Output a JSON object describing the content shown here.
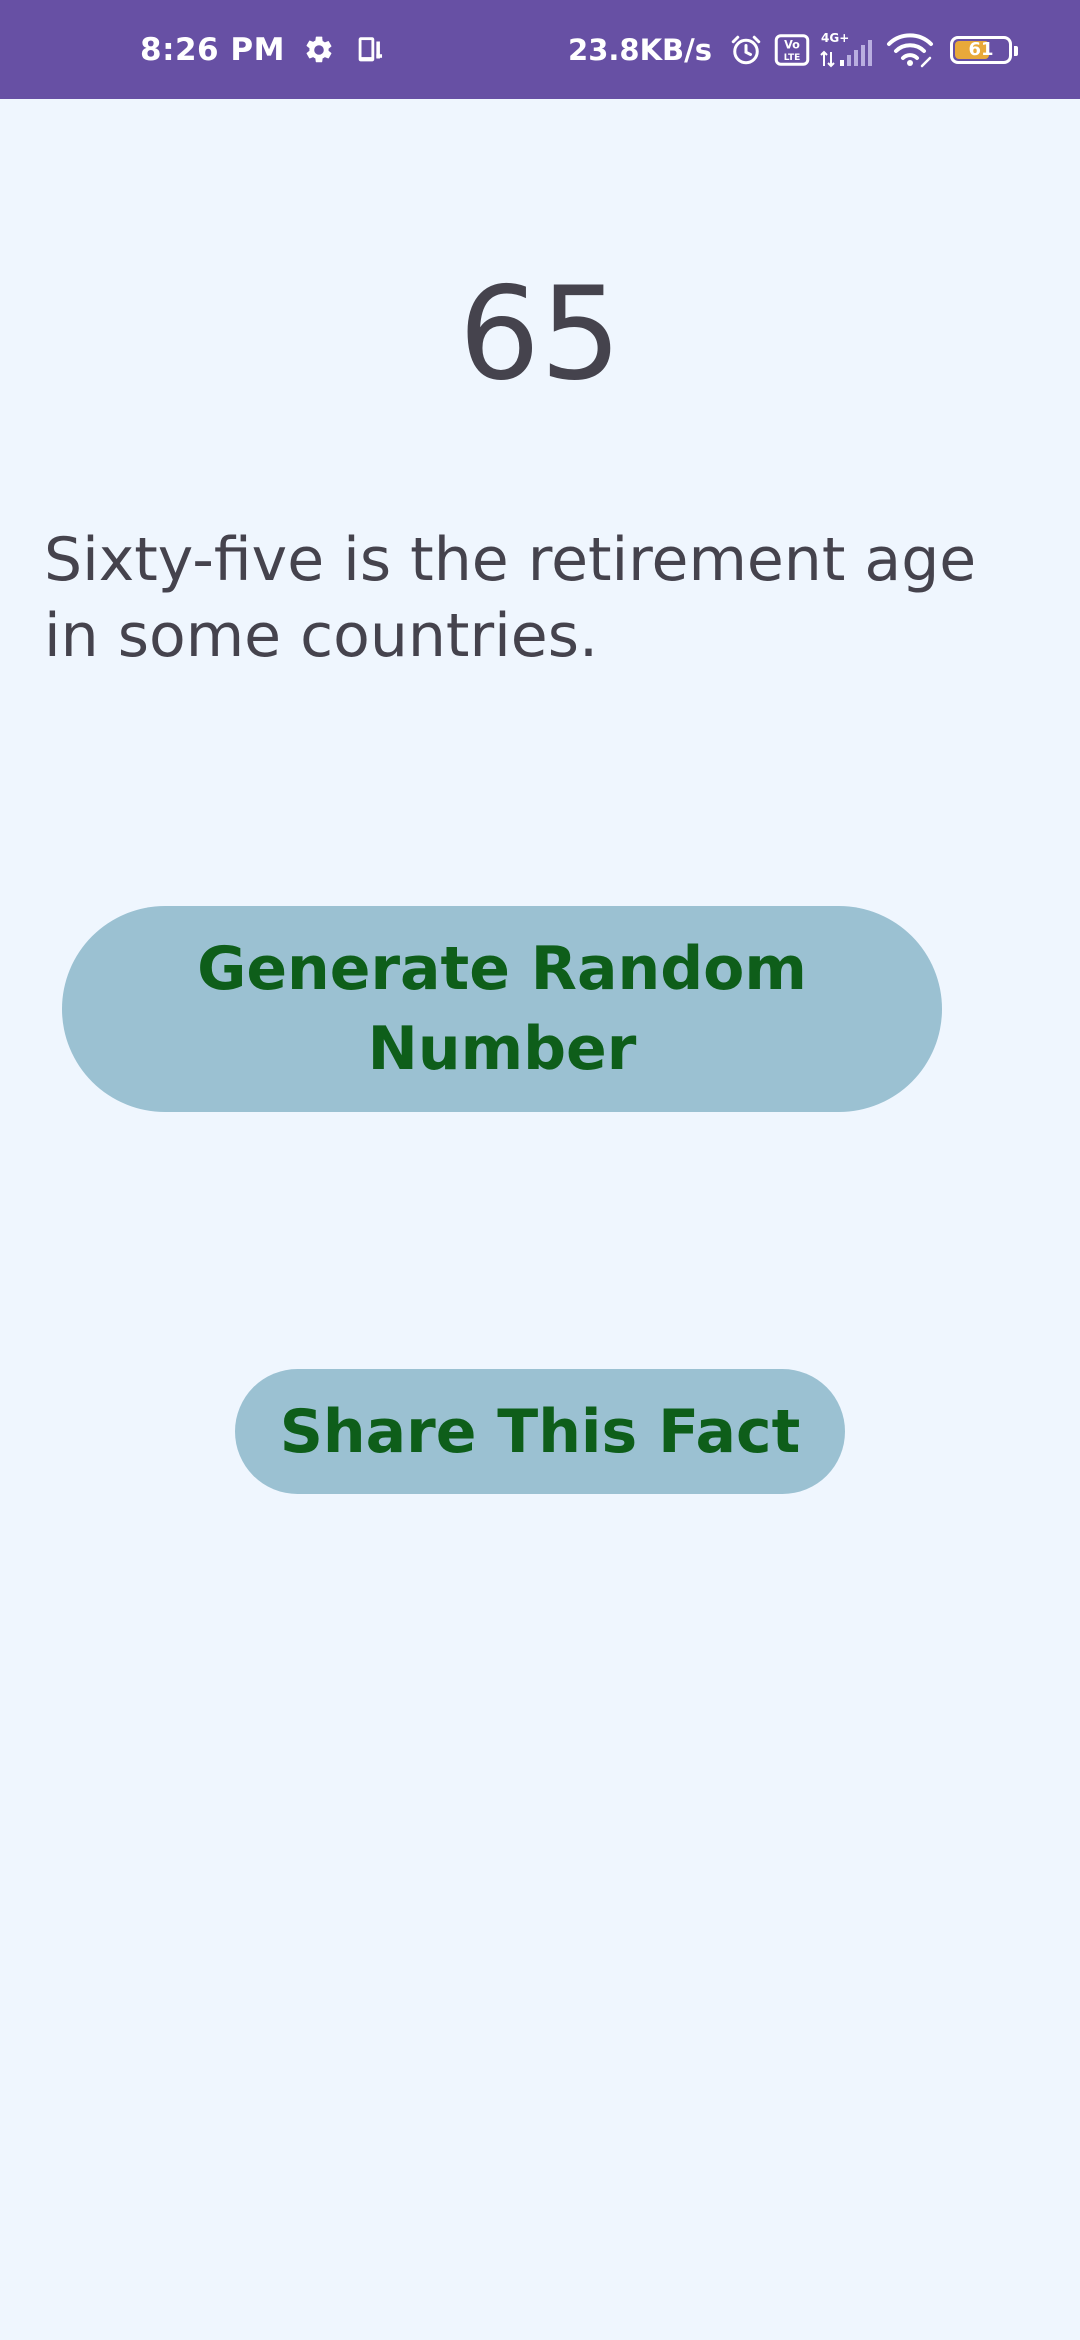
{
  "status_bar": {
    "time": "8:26 PM",
    "net_speed": "23.8KB/s",
    "network_type": "4G+",
    "volte": "Vo LTE",
    "battery_level": "61",
    "icons": [
      "gear-icon",
      "device-sync-icon",
      "alarm-icon",
      "volte-icon",
      "signal-icon",
      "wifi-icon",
      "battery-icon"
    ],
    "background_color": "#6750a4"
  },
  "main": {
    "number": "65",
    "fact": "Sixty-five is the retirement age in some countries.",
    "generate_button_label": "Generate Random Number",
    "share_button_label": "Share This Fact"
  },
  "colors": {
    "background": "#eff6fe",
    "text": "#45434d",
    "button_bg": "#9bc1d2",
    "button_text": "#0e5e1a"
  }
}
